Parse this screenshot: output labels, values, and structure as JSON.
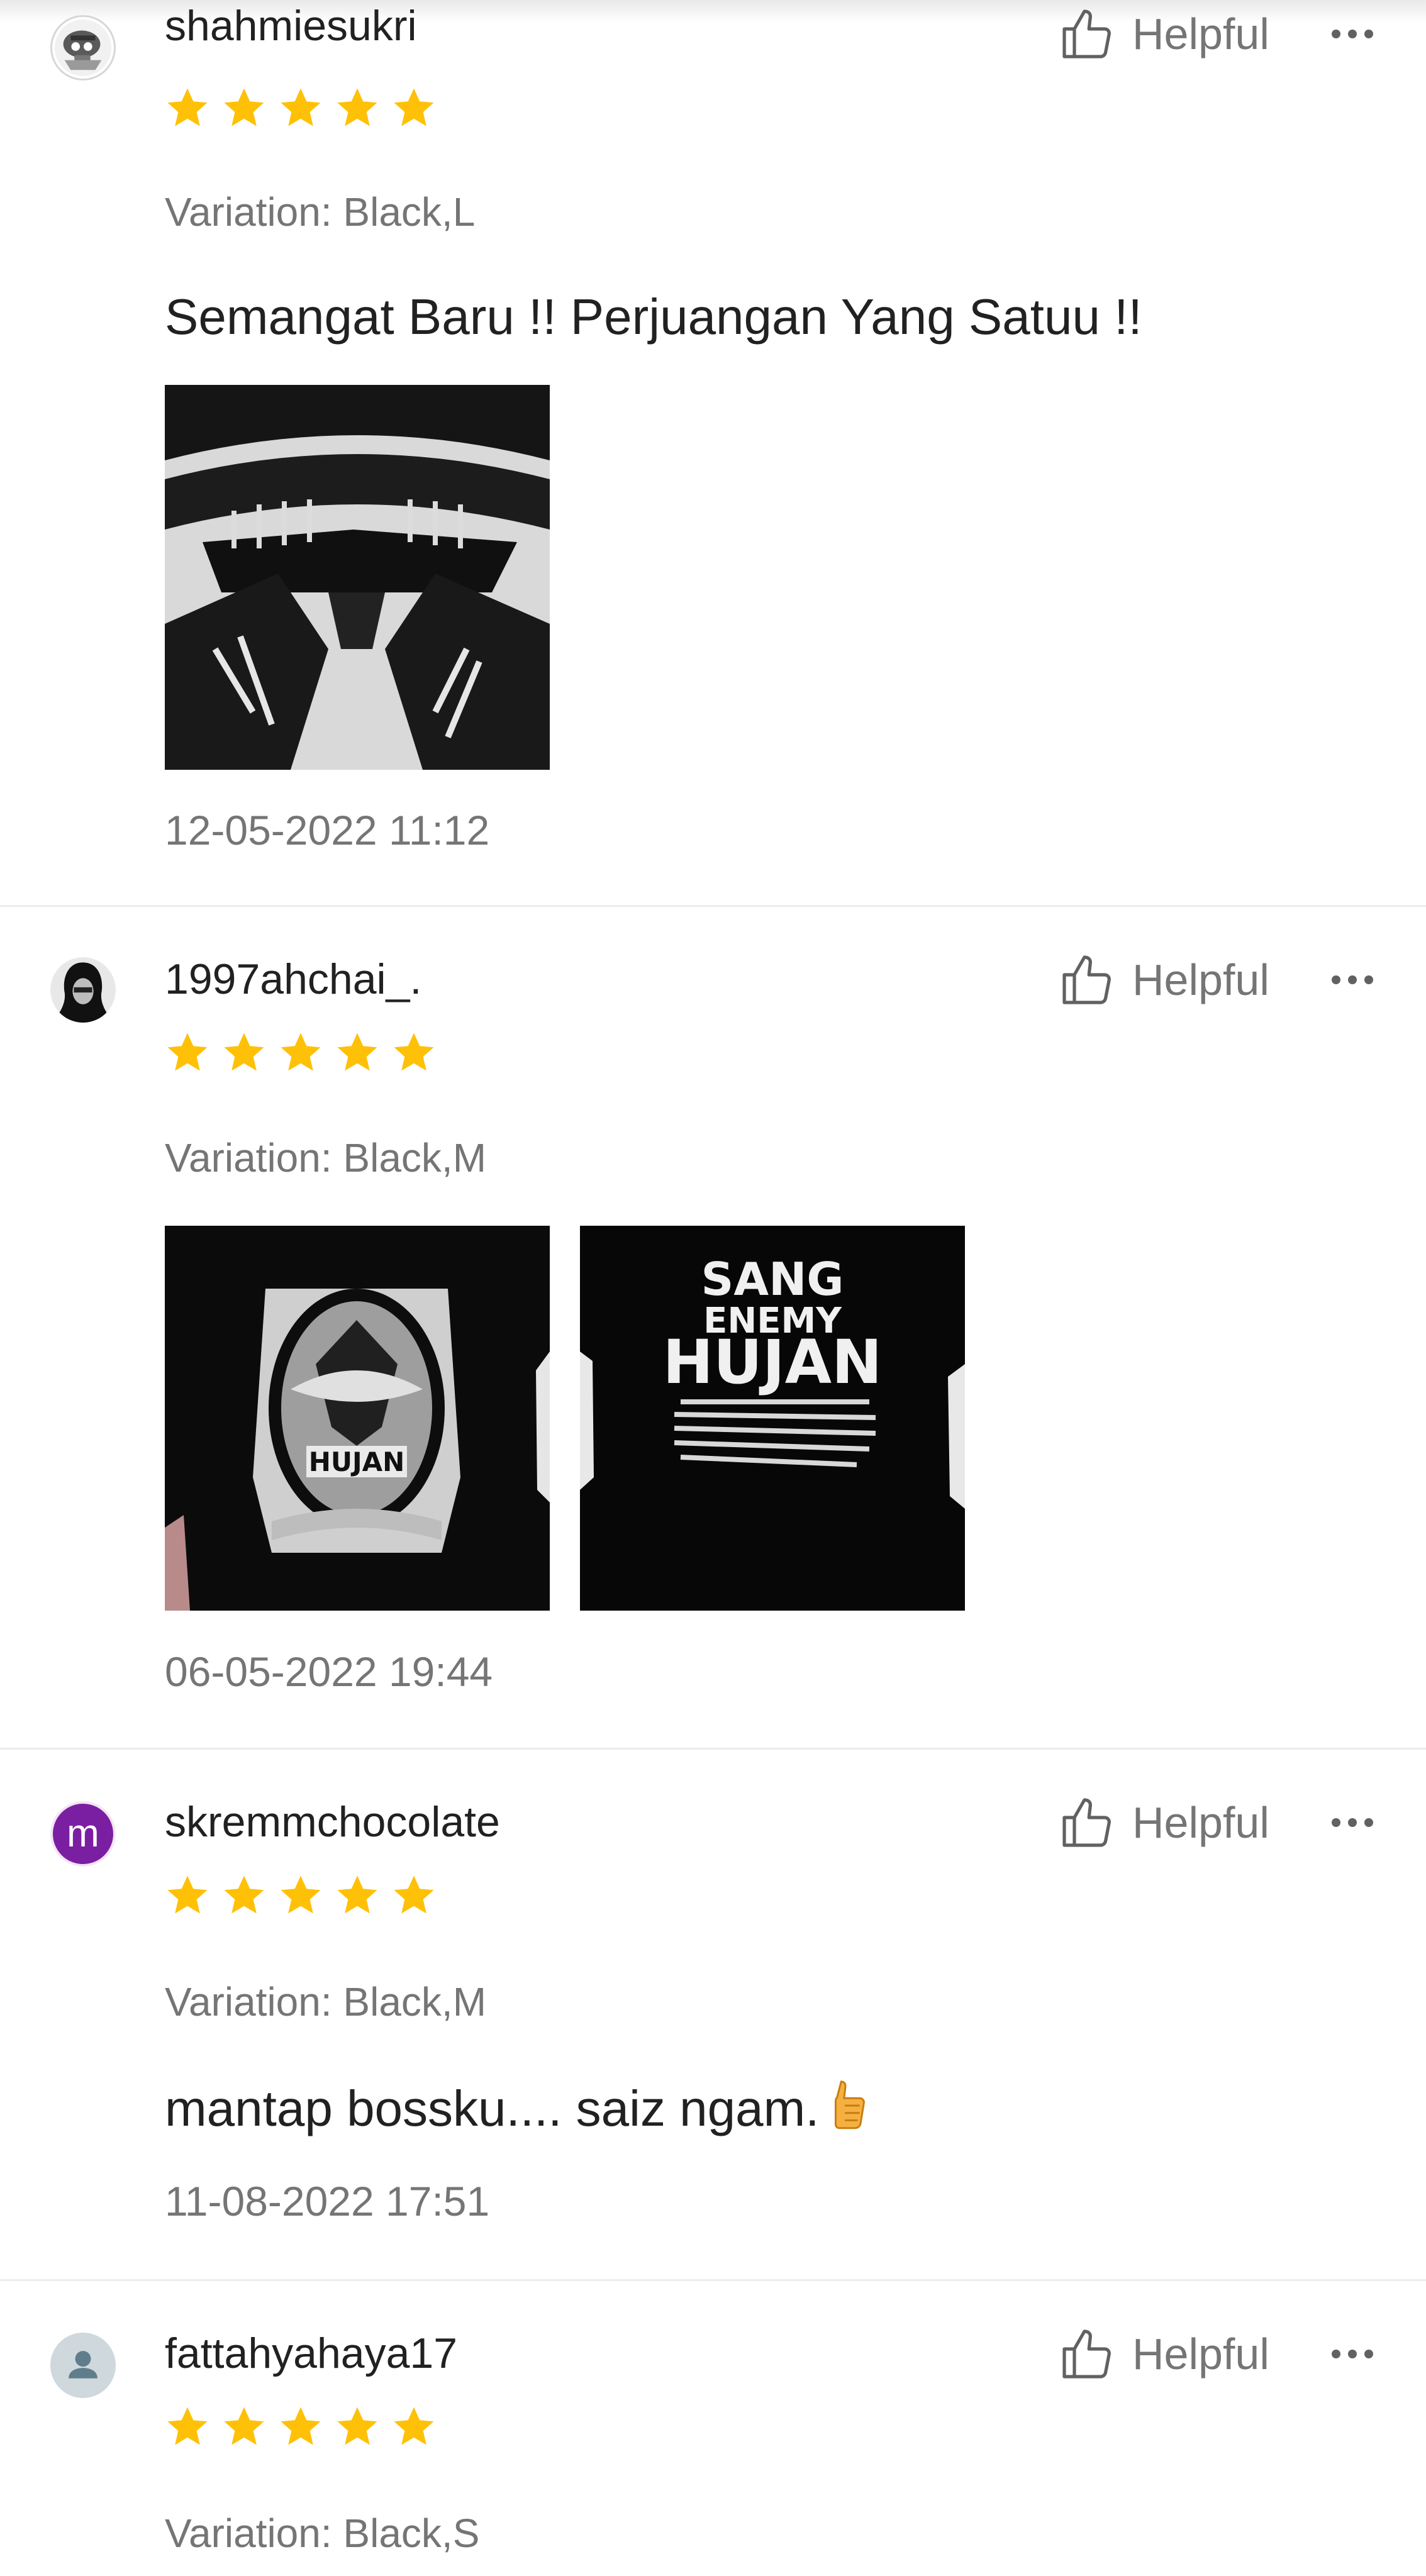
{
  "reviews": [
    {
      "username": "shahmiesukri",
      "rating": 5,
      "variation": "Variation: Black,L",
      "comment": "Semangat Baru !! Perjuangan Yang Satuu !!",
      "date": "12-05-2022 11:12",
      "helpful_label": "Helpful",
      "photos": [
        "photo"
      ]
    },
    {
      "username": "1997ahchai_.",
      "rating": 5,
      "variation": "Variation: Black,M",
      "date": "06-05-2022 19:44",
      "helpful_label": "Helpful",
      "photos": [
        "photo",
        "photo"
      ],
      "photo_text": [
        "HUJAN",
        "SANG",
        "ENEMY",
        "HUJAN"
      ]
    },
    {
      "username": "skremmchocolate",
      "avatar_letter": "m",
      "rating": 5,
      "variation": "Variation: Black,M",
      "comment": "mantap bossku.... saiz ngam.",
      "date": "11-08-2022 17:51",
      "helpful_label": "Helpful"
    },
    {
      "username": "fattahyahaya17",
      "rating": 5,
      "variation": "Variation: Black,S",
      "helpful_label": "Helpful"
    }
  ],
  "icons": {
    "star": "star-icon",
    "helpful": "thumbs-up-icon",
    "more": "more-options-icon",
    "default_avatar": "person-icon",
    "comment_emoji": "thumbs-up-emoji"
  },
  "colors": {
    "star": "#ffc107",
    "text_primary": "#212121",
    "text_secondary": "#757575",
    "divider": "#ececec",
    "avatar_purple": "#7b1fa2"
  }
}
